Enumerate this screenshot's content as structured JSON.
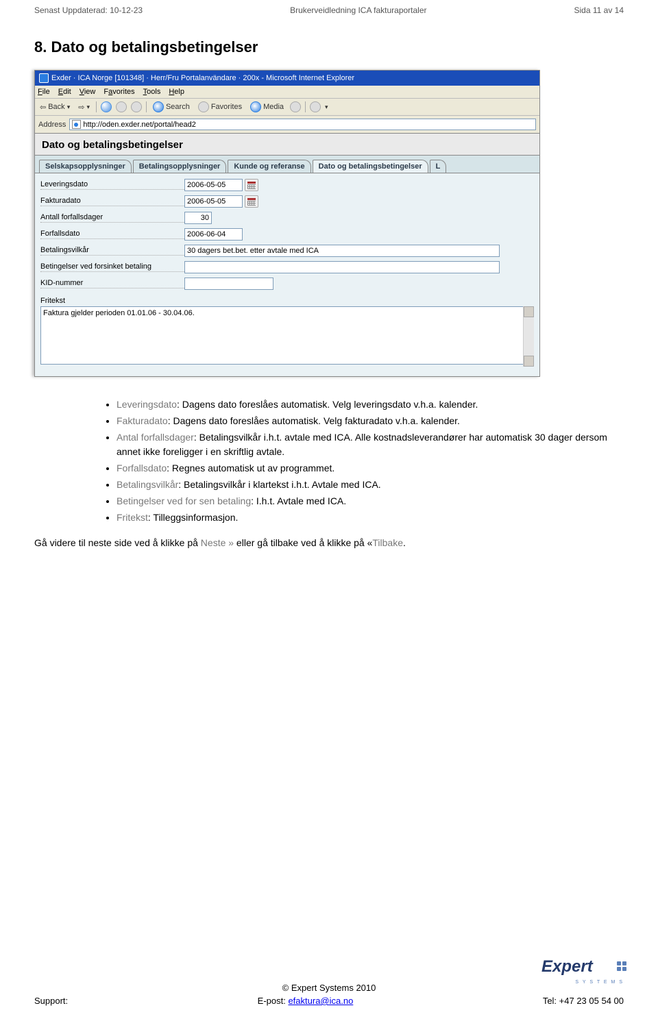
{
  "header": {
    "left": "Senast Uppdaterad: 10-12-23",
    "center": "Brukerveidledning ICA fakturaportaler",
    "right": "Sida 11 av 14"
  },
  "section_heading": "8. Dato og betalingsbetingelser",
  "ie": {
    "title": "Exder · ICA Norge [101348] · Herr/Fru Portalanvändare · 200x - Microsoft Internet Explorer",
    "menus": [
      "File",
      "Edit",
      "View",
      "Favorites",
      "Tools",
      "Help"
    ],
    "toolbar": {
      "back": "Back",
      "search": "Search",
      "favorites": "Favorites",
      "media": "Media"
    },
    "address_label": "Address",
    "url": "http://oden.exder.net/portal/head2"
  },
  "portal": {
    "title": "Dato og betalingsbetingelser",
    "tabs": [
      "Selskapsopplysninger",
      "Betalingsopplysninger",
      "Kunde og referanse",
      "Dato og betalingsbetingelser",
      "L"
    ],
    "active_tab_index": 3,
    "fields": {
      "leveringsdato": {
        "label": "Leveringsdato",
        "value": "2006-05-05"
      },
      "fakturadato": {
        "label": "Fakturadato",
        "value": "2006-05-05"
      },
      "antall_forfallsdager": {
        "label": "Antall forfallsdager",
        "value": "30"
      },
      "forfallsdato": {
        "label": "Forfallsdato",
        "value": "2006-06-04"
      },
      "betalingsvilkar": {
        "label": "Betalingsvilkår",
        "value": "30 dagers bet.bet. etter avtale med ICA"
      },
      "betingelser_forsinket": {
        "label": "Betingelser ved forsinket betaling",
        "value": ""
      },
      "kid_nummer": {
        "label": "KID-nummer",
        "value": ""
      },
      "fritekst_label": "Fritekst",
      "fritekst_value": "Faktura gjelder perioden 01.01.06 - 30.04.06."
    }
  },
  "bullets": {
    "b1": {
      "term": "Leveringsdato",
      "rest": ": Dagens dato foreslåes automatisk. Velg leveringsdato v.h.a. kalender."
    },
    "b2": {
      "term": "Fakturadato",
      "rest": ": Dagens dato foreslåes automatisk. Velg fakturadato v.h.a. kalender."
    },
    "b3": {
      "term": "Antal forfallsdager",
      "rest": ": Betalingsvilkår i.h.t. avtale med ICA. Alle kostnadsleverandører har automatisk 30 dager dersom annet ikke foreligger i en skriftlig avtale."
    },
    "b4": {
      "term": "Forfallsdato",
      "rest": ": Regnes automatisk ut av programmet."
    },
    "b5": {
      "term": "Betalingsvilkår",
      "rest": ": Betalingsvilkår i klartekst i.h.t. Avtale med ICA."
    },
    "b6": {
      "term": "Betingelser ved for sen betaling",
      "rest": ": I.h.t. Avtale med ICA."
    },
    "b7": {
      "term": "Fritekst",
      "rest": ": Tilleggsinformasjon."
    }
  },
  "nav_note": {
    "prefix": "Gå videre til neste side ved å klikke på ",
    "neste": "Neste »",
    "middle": " eller gå tilbake ved å klikke på «",
    "tilbake": "Tilbake",
    "suffix": "."
  },
  "footer": {
    "copyright": "© Expert Systems 2010",
    "support": "Support:",
    "email_label": "E-post: ",
    "email": "efaktura@ica.no",
    "tel": "Tel: +47 23 05 54 00"
  },
  "logo": {
    "text": "Expert",
    "sub": "S Y S T E M S"
  }
}
